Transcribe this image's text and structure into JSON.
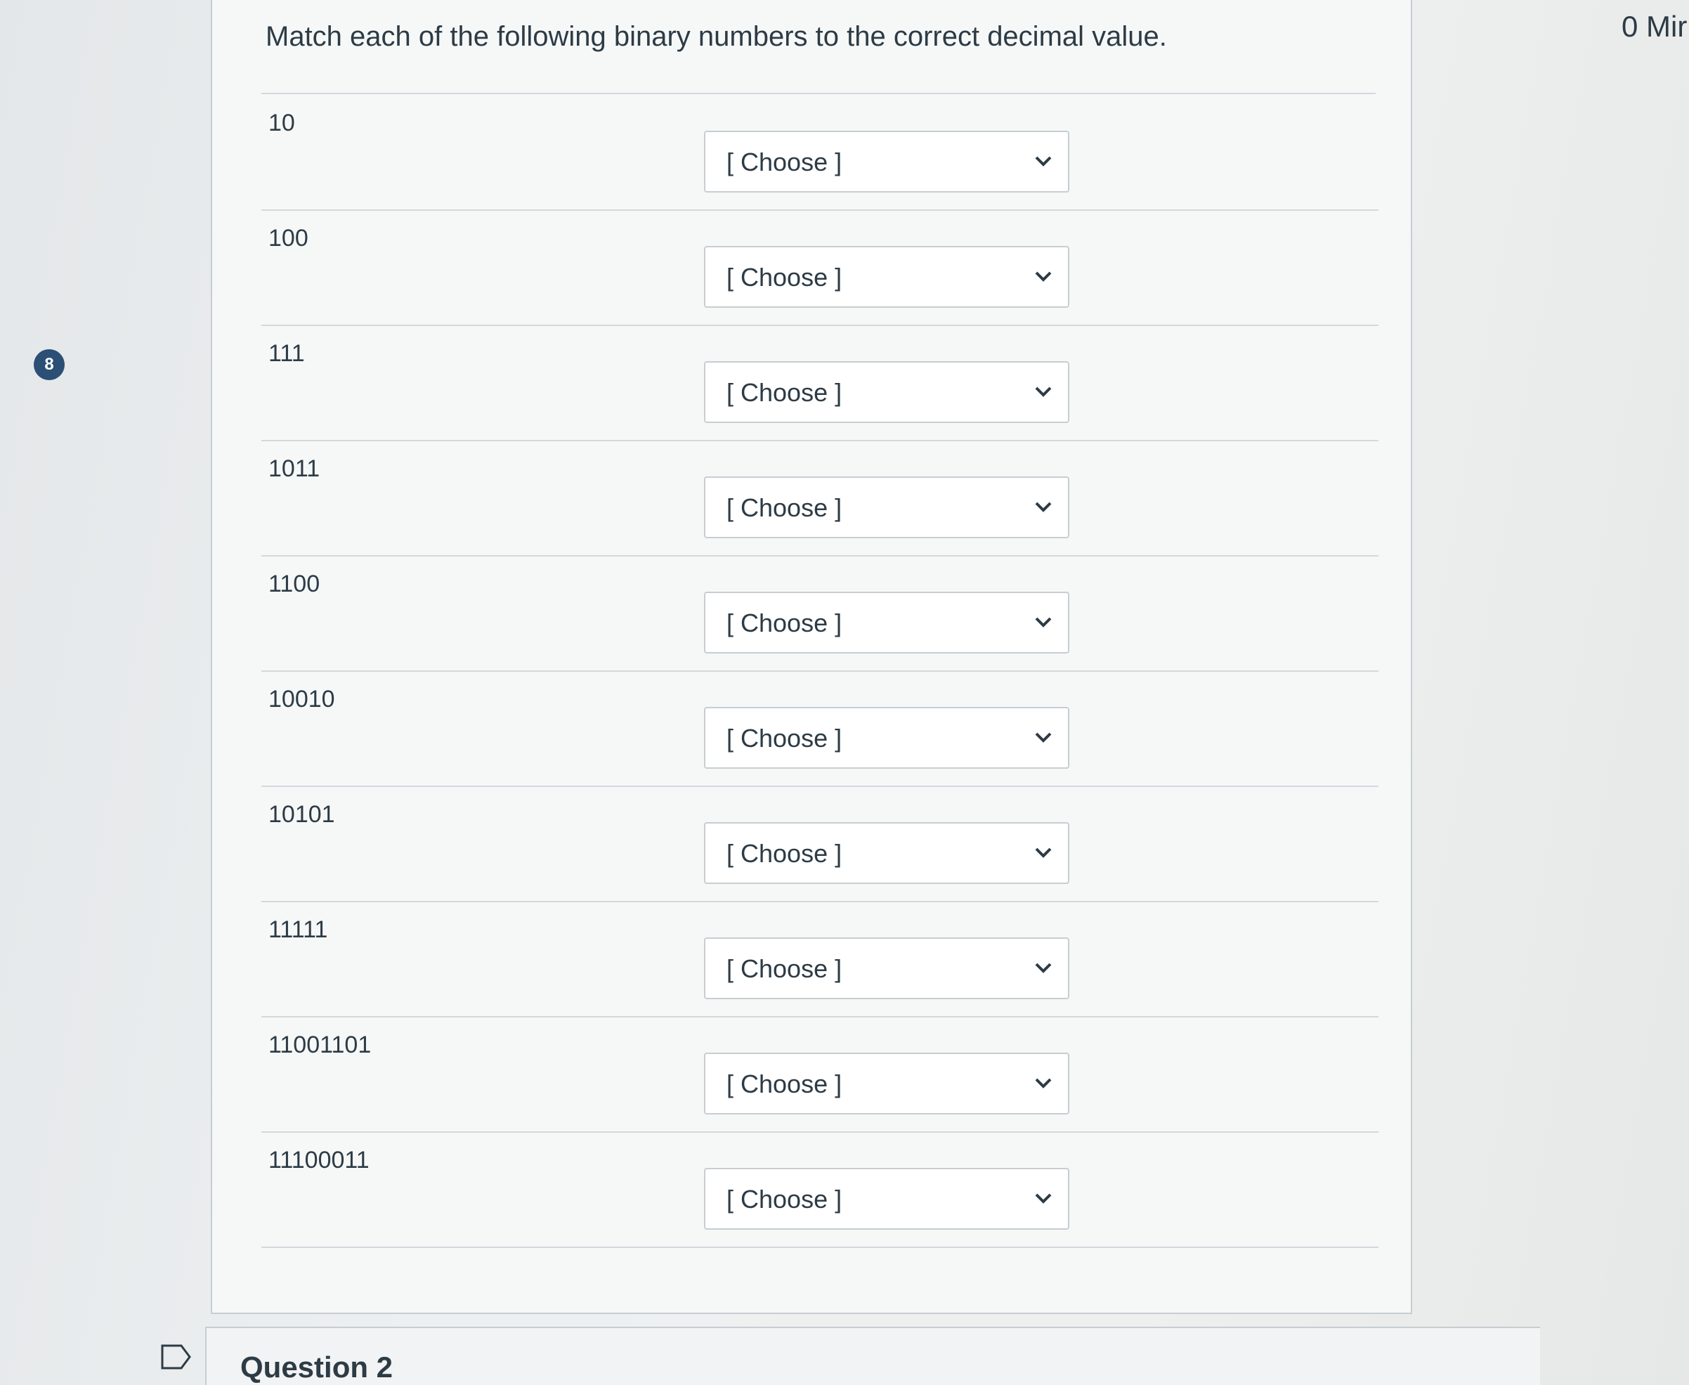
{
  "badge": {
    "count": "8"
  },
  "timer": {
    "label": "0 Mir"
  },
  "question": {
    "prompt": "Match each of the following binary numbers to the correct decimal value.",
    "rows": [
      {
        "binary": "10",
        "selected": "[ Choose ]"
      },
      {
        "binary": "100",
        "selected": "[ Choose ]"
      },
      {
        "binary": "111",
        "selected": "[ Choose ]"
      },
      {
        "binary": "1011",
        "selected": "[ Choose ]"
      },
      {
        "binary": "1100",
        "selected": "[ Choose ]"
      },
      {
        "binary": "10010",
        "selected": "[ Choose ]"
      },
      {
        "binary": "10101",
        "selected": "[ Choose ]"
      },
      {
        "binary": "11111",
        "selected": "[ Choose ]"
      },
      {
        "binary": "11001101",
        "selected": "[ Choose ]"
      },
      {
        "binary": "11100011",
        "selected": "[ Choose ]"
      }
    ]
  },
  "next_question": {
    "title": "Question 2"
  },
  "colors": {
    "badge": "#2b4f75",
    "text": "#2d3b45",
    "border": "#c7cdd1"
  }
}
